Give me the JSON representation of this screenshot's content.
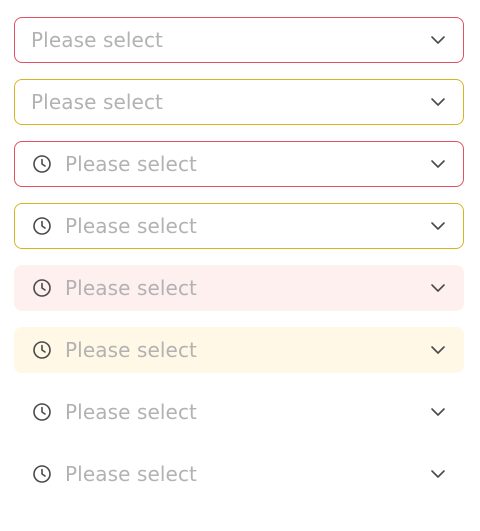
{
  "selects": [
    {
      "placeholder": "Please select",
      "variant": "outlined",
      "status": "error",
      "prefix_icon": null,
      "suffix_icon": "chevron-down-icon"
    },
    {
      "placeholder": "Please select",
      "variant": "outlined",
      "status": "warning",
      "prefix_icon": null,
      "suffix_icon": "chevron-down-icon"
    },
    {
      "placeholder": "Please select",
      "variant": "outlined",
      "status": "error",
      "prefix_icon": "clock-icon",
      "suffix_icon": "chevron-down-icon"
    },
    {
      "placeholder": "Please select",
      "variant": "outlined",
      "status": "warning",
      "prefix_icon": "clock-icon",
      "suffix_icon": "chevron-down-icon"
    },
    {
      "placeholder": "Please select",
      "variant": "filled",
      "status": "error",
      "prefix_icon": "clock-icon",
      "suffix_icon": "chevron-down-icon"
    },
    {
      "placeholder": "Please select",
      "variant": "filled",
      "status": "warning",
      "prefix_icon": "clock-icon",
      "suffix_icon": "chevron-down-icon"
    },
    {
      "placeholder": "Please select",
      "variant": "borderless",
      "status": "error",
      "prefix_icon": "clock-icon",
      "suffix_icon": "chevron-down-icon"
    },
    {
      "placeholder": "Please select",
      "variant": "borderless",
      "status": "warning",
      "prefix_icon": "clock-icon",
      "suffix_icon": "chevron-down-icon"
    }
  ],
  "colors": {
    "error_border": "#e0525f",
    "warning_border": "#d8b422",
    "error_fill": "#fff0f0",
    "warning_fill": "#fff8e6",
    "placeholder_text": "#b2b2b2",
    "icon": "#4a4a4a"
  }
}
